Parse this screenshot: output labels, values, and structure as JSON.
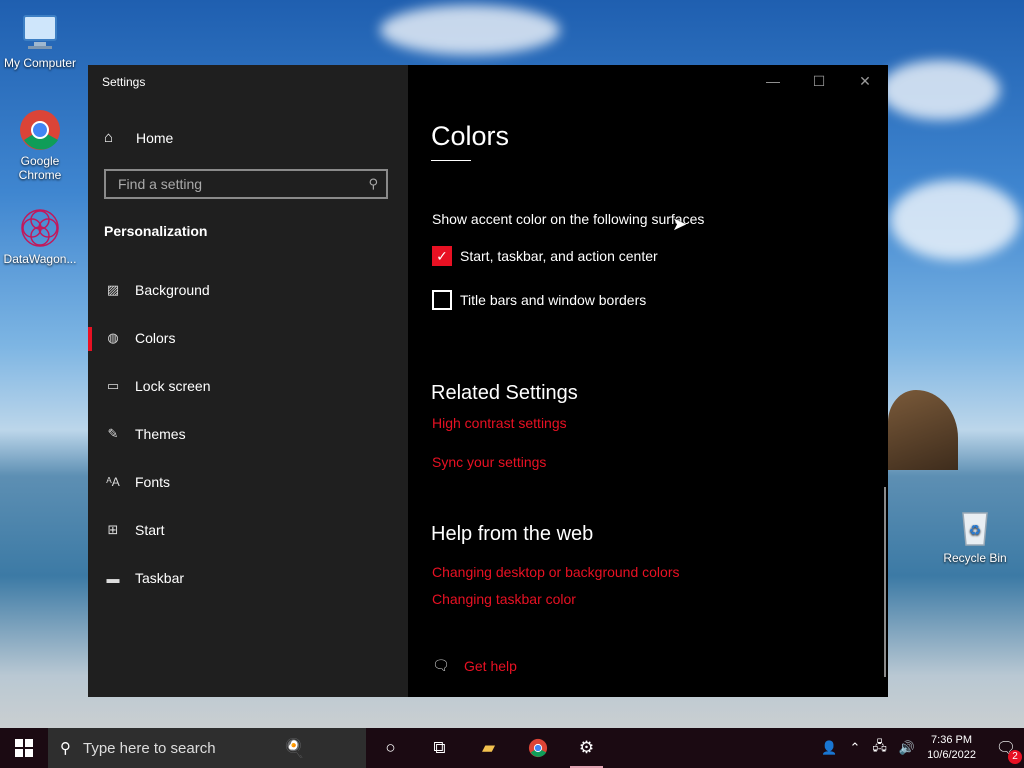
{
  "desktop": {
    "icons": [
      {
        "label": "My Computer",
        "icon": "monitor-icon"
      },
      {
        "label": "Google Chrome",
        "icon": "chrome-icon"
      },
      {
        "label": "DataWagon...",
        "icon": "datawagon-icon"
      },
      {
        "label": "Recycle Bin",
        "icon": "recycle-bin-icon"
      }
    ]
  },
  "window": {
    "title": "Settings",
    "controls": {
      "minimize": "—",
      "maximize": "☐",
      "close": "✕"
    }
  },
  "sidebar": {
    "home_label": "Home",
    "search_placeholder": "Find a setting",
    "section_title": "Personalization",
    "items": [
      {
        "label": "Background",
        "icon": "picture-icon",
        "active": false
      },
      {
        "label": "Colors",
        "icon": "palette-icon",
        "active": true
      },
      {
        "label": "Lock screen",
        "icon": "lock-screen-icon",
        "active": false
      },
      {
        "label": "Themes",
        "icon": "brush-icon",
        "active": false
      },
      {
        "label": "Fonts",
        "icon": "fonts-icon",
        "active": false
      },
      {
        "label": "Start",
        "icon": "start-grid-icon",
        "active": false
      },
      {
        "label": "Taskbar",
        "icon": "taskbar-icon",
        "active": false
      }
    ]
  },
  "main": {
    "title": "Colors",
    "accent_surfaces_label": "Show accent color on the following surfaces",
    "checkboxes": [
      {
        "label": "Start, taskbar, and action center",
        "checked": true
      },
      {
        "label": "Title bars and window borders",
        "checked": false
      }
    ],
    "related_title": "Related Settings",
    "related_links": [
      "High contrast settings",
      "Sync your settings"
    ],
    "help_title": "Help from the web",
    "help_links": [
      "Changing desktop or background colors",
      "Changing taskbar color"
    ],
    "get_help_label": "Get help"
  },
  "taskbar": {
    "search_placeholder": "Type here to search",
    "time": "7:36 PM",
    "date": "10/6/2022",
    "notification_count": "2"
  },
  "colors": {
    "accent": "#e81123",
    "sidebar_bg": "#1f1f1f",
    "content_bg": "#000000",
    "taskbar_bg": "#1b0a12"
  }
}
